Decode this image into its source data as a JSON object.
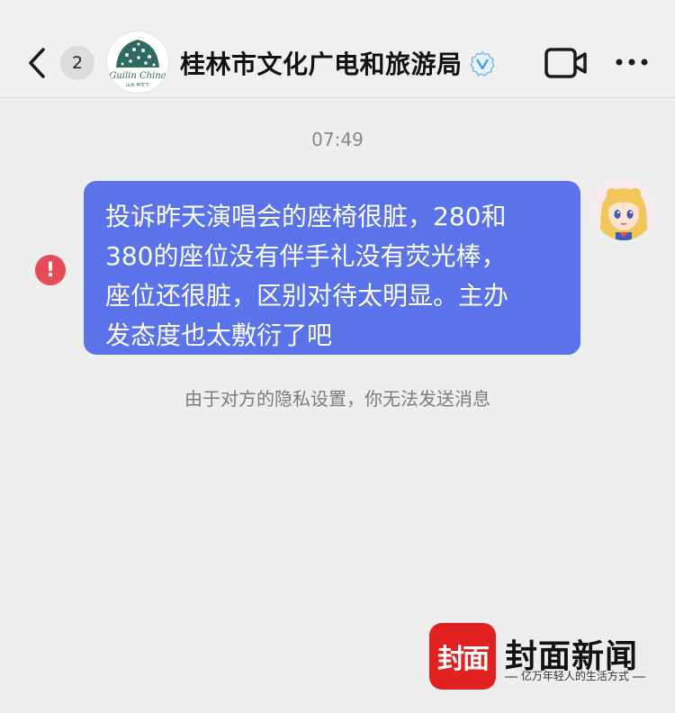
{
  "header": {
    "back_icon": "chevron-left-icon",
    "unread_count": "2",
    "avatar_text": "Guilin China",
    "avatar_subtext": "山水·甲天下",
    "title": "桂林市文化广电和旅游局",
    "verified_icon": "verified-v-icon",
    "video_call_icon": "video-camera-icon",
    "more_icon": "more-dots-icon"
  },
  "chat": {
    "timestamp": "07:49",
    "message": {
      "status_icon": "send-failed-icon",
      "status_symbol": "!",
      "lines": [
        "投诉昨天演唱会的座椅很脏，280和",
        "380的座位没有伴手礼没有荧光棒，",
        "座位还很脏，区别对待太明显。主办",
        "发态度也太敷衍了吧"
      ],
      "bubble_color": "#5a72ea",
      "sender_avatar_icon": "anime-avatar-icon"
    },
    "system_notice": "由于对方的隐私设置，你无法发送消息"
  },
  "watermark": {
    "logo_text": "封面",
    "name": "封面新闻",
    "slogan": "亿万年轻人的生活方式",
    "brand_color": "#e1211f"
  }
}
